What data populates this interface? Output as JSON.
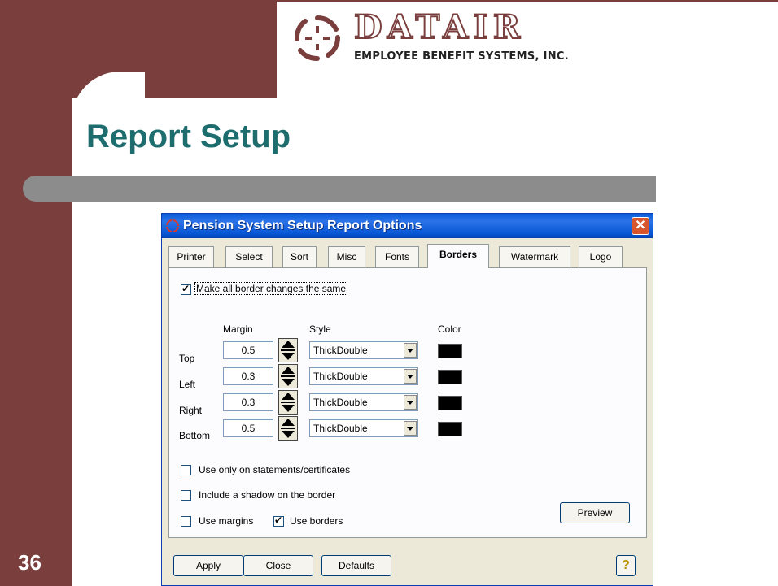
{
  "slide": {
    "title": "Report Setup",
    "number": "36",
    "logo_name": "DATAIR",
    "logo_tagline": "EMPLOYEE BENEFIT SYSTEMS, INC."
  },
  "dialog": {
    "title": "Pension System Setup Report Options",
    "tabs": [
      {
        "label": "Printer"
      },
      {
        "label": "Select"
      },
      {
        "label": "Sort"
      },
      {
        "label": "Misc"
      },
      {
        "label": "Fonts"
      },
      {
        "label": "Borders"
      },
      {
        "label": "Watermark"
      },
      {
        "label": "Logo"
      }
    ],
    "active_tab": "Borders",
    "make_same": {
      "label": "Make all border changes the same",
      "checked": true
    },
    "headers": {
      "margin": "Margin",
      "style": "Style",
      "color": "Color"
    },
    "rows": [
      {
        "label": "Top",
        "margin": "0.5",
        "style": "ThickDouble",
        "color": "#000000"
      },
      {
        "label": "Left",
        "margin": "0.3",
        "style": "ThickDouble",
        "color": "#000000"
      },
      {
        "label": "Right",
        "margin": "0.3",
        "style": "ThickDouble",
        "color": "#000000"
      },
      {
        "label": "Bottom",
        "margin": "0.5",
        "style": "ThickDouble",
        "color": "#000000"
      }
    ],
    "options": {
      "statements_only": {
        "label": "Use only on statements/certificates",
        "checked": false
      },
      "shadow": {
        "label": "Include a shadow on the border",
        "checked": false
      },
      "use_margins": {
        "label": "Use margins",
        "checked": false
      },
      "use_borders": {
        "label": "Use borders",
        "checked": true
      }
    },
    "buttons": {
      "preview": "Preview",
      "apply": "Apply",
      "close": "Close",
      "defaults": "Defaults",
      "help": "?"
    }
  }
}
